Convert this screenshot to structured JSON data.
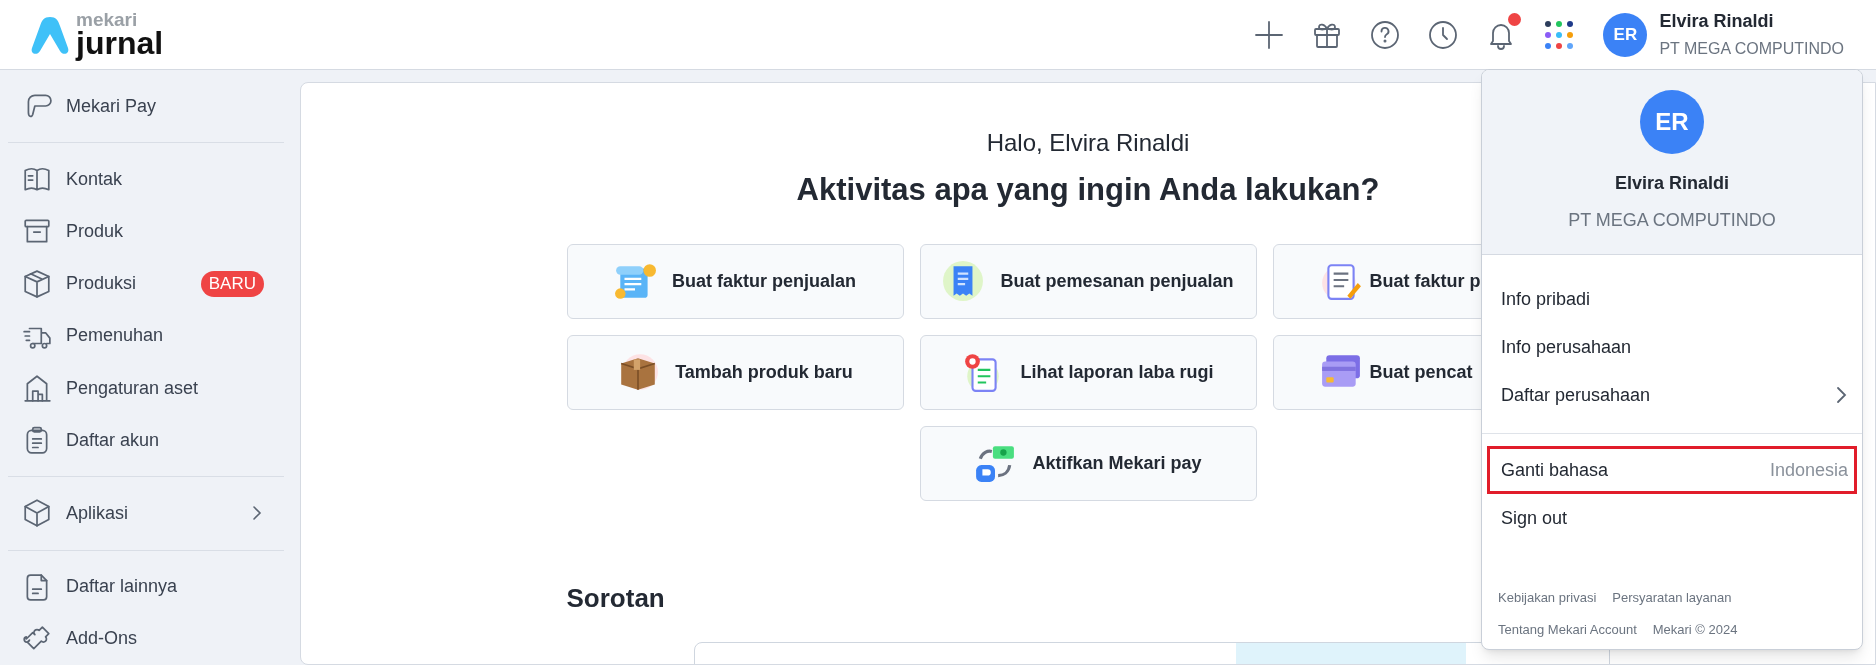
{
  "logo": {
    "brand": "mekari",
    "product": "jurnal"
  },
  "header": {
    "actions": [
      {
        "kind": "plus"
      },
      {
        "kind": "gift"
      },
      {
        "kind": "help"
      },
      {
        "kind": "clock"
      },
      {
        "kind": "bell",
        "has_notification": true
      },
      {
        "kind": "apps"
      }
    ],
    "user": {
      "initials": "ER",
      "name": "Elvira Rinaldi",
      "company": "PT MEGA COMPUTINDO"
    }
  },
  "sidebar": {
    "groups": [
      [
        {
          "label": "Mekari Pay"
        }
      ],
      [
        {
          "label": "Kontak"
        },
        {
          "label": "Produk"
        },
        {
          "label": "Produksi",
          "badge": "BARU"
        },
        {
          "label": "Pemenuhan"
        },
        {
          "label": "Pengaturan aset"
        },
        {
          "label": "Daftar akun"
        }
      ],
      [
        {
          "label": "Aplikasi",
          "has_submenu": true
        }
      ],
      [
        {
          "label": "Daftar lainnya"
        },
        {
          "label": "Add-Ons"
        }
      ]
    ]
  },
  "main": {
    "greeting": "Halo, Elvira Rinaldi",
    "title": "Aktivitas apa yang ingin Anda lakukan?",
    "actions": [
      {
        "label": "Buat faktur penjualan"
      },
      {
        "label": "Buat pemesanan penjualan"
      },
      {
        "label": "Buat faktur p"
      },
      {
        "label": "Tambah produk baru"
      },
      {
        "label": "Lihat laporan laba rugi"
      },
      {
        "label": "Buat pencat"
      },
      {
        "label": "Aktifkan Mekari pay"
      }
    ],
    "section_title": "Sorotan"
  },
  "account_menu": {
    "initials": "ER",
    "name": "Elvira Rinaldi",
    "company": "PT MEGA COMPUTINDO",
    "groups": [
      [
        {
          "label": "Info pribadi",
          "has_submenu": false,
          "highlighted": false
        },
        {
          "label": "Info perusahaan",
          "has_submenu": false,
          "highlighted": false
        },
        {
          "label": "Daftar perusahaan",
          "has_submenu": true,
          "highlighted": false
        }
      ],
      [
        {
          "label": "Ganti bahasa",
          "value": "Indonesia",
          "has_submenu": false,
          "highlighted": true
        },
        {
          "label": "Sign out",
          "has_submenu": false,
          "highlighted": false
        }
      ]
    ],
    "footer_links": [
      [
        "Kebijakan privasi",
        "Persyaratan layanan"
      ],
      [
        "Tentang Mekari Account",
        "Mekari © 2024"
      ]
    ]
  }
}
